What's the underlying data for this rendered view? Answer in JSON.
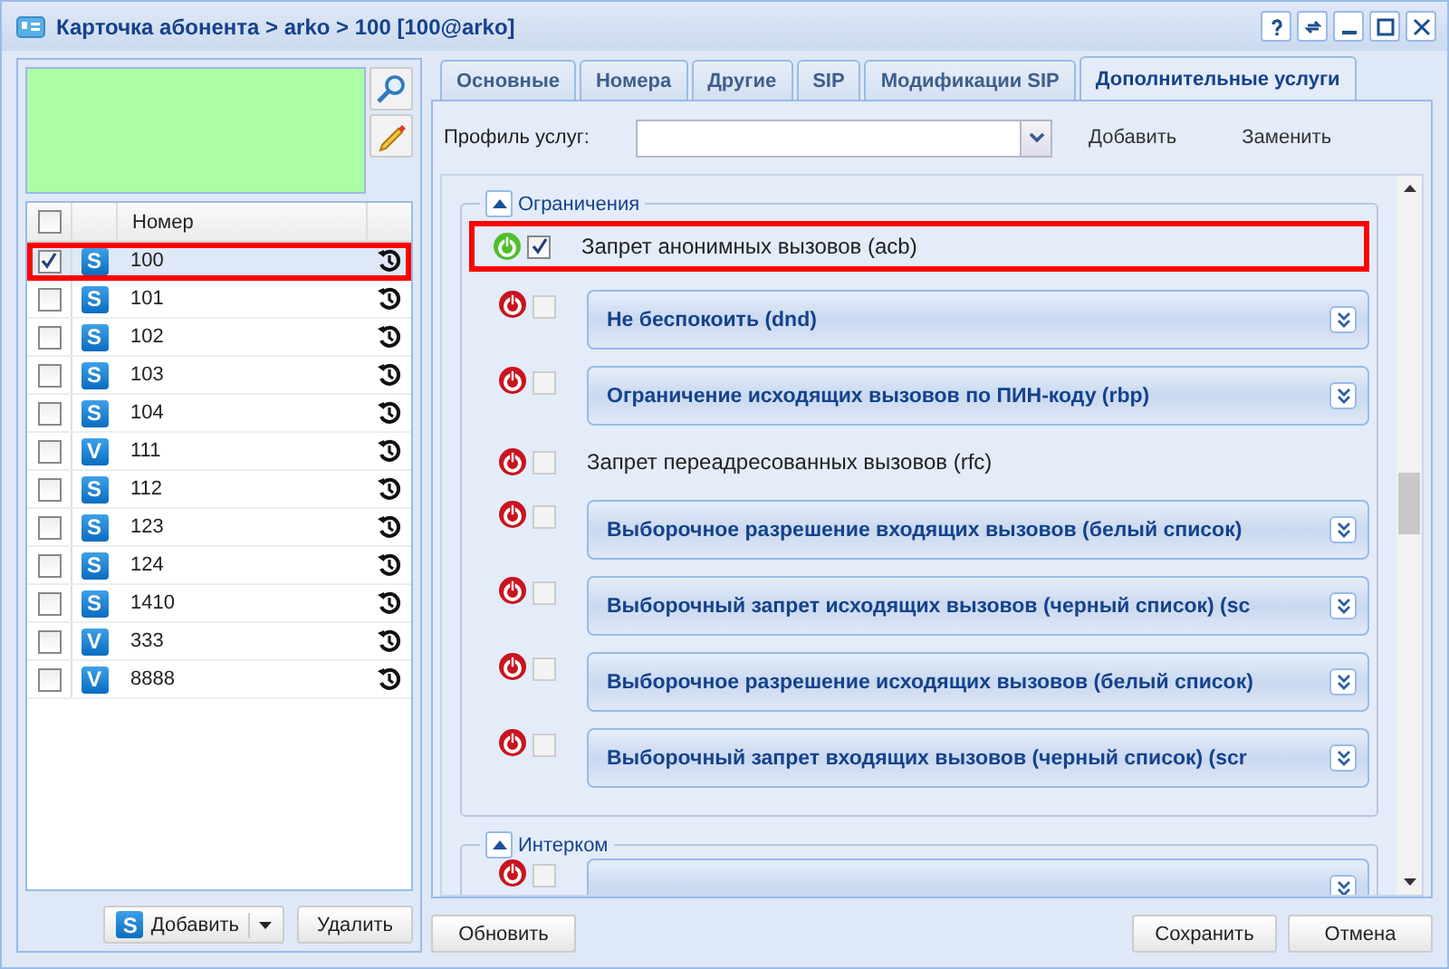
{
  "window": {
    "title": "Карточка абонента > arko > 100 [100@arko]"
  },
  "left": {
    "all_checked": false,
    "columns": [
      "Номер"
    ],
    "rows": [
      {
        "type": "S",
        "number": "100",
        "checked": true,
        "highlighted": true
      },
      {
        "type": "S",
        "number": "101",
        "checked": false,
        "highlighted": false
      },
      {
        "type": "S",
        "number": "102",
        "checked": false,
        "highlighted": false
      },
      {
        "type": "S",
        "number": "103",
        "checked": false,
        "highlighted": false
      },
      {
        "type": "S",
        "number": "104",
        "checked": false,
        "highlighted": false
      },
      {
        "type": "V",
        "number": "111",
        "checked": false,
        "highlighted": false
      },
      {
        "type": "S",
        "number": "112",
        "checked": false,
        "highlighted": false
      },
      {
        "type": "S",
        "number": "123",
        "checked": false,
        "highlighted": false
      },
      {
        "type": "S",
        "number": "124",
        "checked": false,
        "highlighted": false
      },
      {
        "type": "S",
        "number": "1410",
        "checked": false,
        "highlighted": false
      },
      {
        "type": "V",
        "number": "333",
        "checked": false,
        "highlighted": false
      },
      {
        "type": "V",
        "number": "8888",
        "checked": false,
        "highlighted": false
      }
    ],
    "buttons": {
      "add_type": "S",
      "add": "Добавить",
      "delete": "Удалить"
    }
  },
  "tabs": [
    {
      "label": "Основные",
      "selected": false
    },
    {
      "label": "Номера",
      "selected": false
    },
    {
      "label": "Другие",
      "selected": false
    },
    {
      "label": "SIP",
      "selected": false
    },
    {
      "label": "Модификации SIP",
      "selected": false
    },
    {
      "label": "Дополнительные услуги",
      "selected": true
    }
  ],
  "profile": {
    "label": "Профиль услуг:",
    "add": "Добавить",
    "replace": "Заменить"
  },
  "groups": [
    {
      "title": "Ограничения",
      "items": [
        {
          "kind": "plain",
          "label": "Запрет анонимных вызовов (acb)",
          "enabled": true,
          "checked": true,
          "highlighted": true
        },
        {
          "kind": "panel",
          "label": "Не беспокоить (dnd)",
          "enabled": false,
          "checked": false,
          "highlighted": false
        },
        {
          "kind": "panel",
          "label": "Ограничение исходящих вызовов по ПИН-коду (rbp)",
          "enabled": false,
          "checked": false,
          "highlighted": false
        },
        {
          "kind": "plain",
          "label": "Запрет переадресованных вызовов (rfc)",
          "enabled": false,
          "checked": false,
          "highlighted": false
        },
        {
          "kind": "panel",
          "label": "Выборочное разрешение входящих вызовов (белый список)",
          "enabled": false,
          "checked": false,
          "highlighted": false
        },
        {
          "kind": "panel",
          "label": "Выборочный запрет исходящих вызовов (черный список) (sc",
          "enabled": false,
          "checked": false,
          "highlighted": false
        },
        {
          "kind": "panel",
          "label": "Выборочное разрешение исходящих вызовов (белый список)",
          "enabled": false,
          "checked": false,
          "highlighted": false
        },
        {
          "kind": "panel",
          "label": "Выборочный запрет входящих вызовов (черный список) (scr",
          "enabled": false,
          "checked": false,
          "highlighted": false
        }
      ]
    },
    {
      "title": "Интерком",
      "items": [
        {
          "kind": "panel",
          "enabled": false,
          "checked": false,
          "highlighted": false
        }
      ]
    }
  ],
  "footer": {
    "refresh": "Обновить",
    "save": "Сохранить",
    "cancel": "Отмена"
  }
}
